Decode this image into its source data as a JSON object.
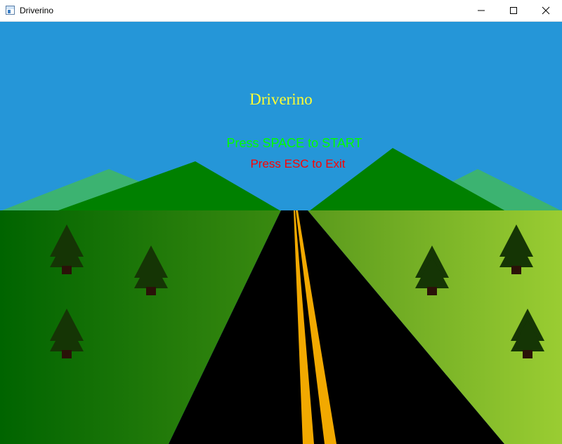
{
  "window": {
    "title": "Driverino",
    "icon": "app-window-icon",
    "controls": [
      {
        "name": "minimize",
        "icon": "minimize-icon"
      },
      {
        "name": "maximize",
        "icon": "maximize-icon"
      },
      {
        "name": "close",
        "icon": "close-icon"
      }
    ]
  },
  "game": {
    "title": "Driverino",
    "start_prompt": "Press SPACE to START",
    "exit_prompt": "Press ESC to Exit"
  },
  "colors": {
    "sky": "#2596d8",
    "far_mountain": "#3cb371",
    "near_mountain": "#008000",
    "grass_left_dark": "#006400",
    "grass_left_light": "#3a8a10",
    "grass_right_dark": "#5a9a1c",
    "grass_right_light": "#9acd32",
    "road": "#000000",
    "road_line": "#f2a900",
    "tree": "#153505",
    "trunk": "#2a1208",
    "title_color": "#ffff33",
    "start_color": "#00ff00",
    "exit_color": "#ff0000"
  }
}
